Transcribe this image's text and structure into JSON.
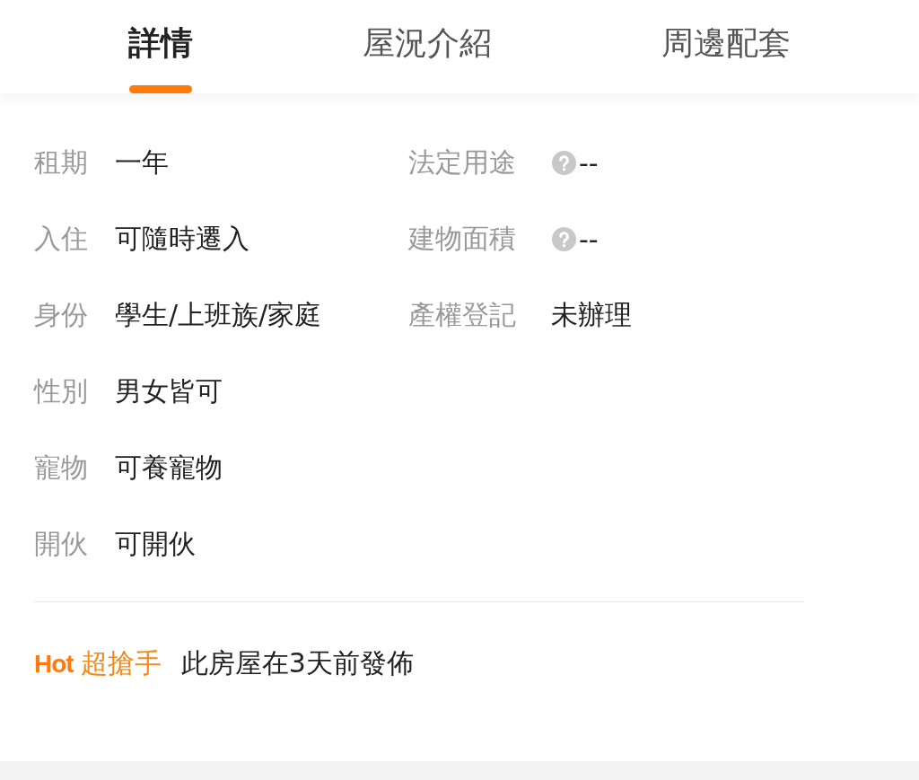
{
  "tabs": [
    {
      "label": "詳情",
      "selected": true
    },
    {
      "label": "屋況介紹",
      "selected": false
    },
    {
      "label": "周邊配套",
      "selected": false
    }
  ],
  "details_left": [
    {
      "label": "租期",
      "value": "一年"
    },
    {
      "label": "入住",
      "value": "可隨時遷入"
    },
    {
      "label": "身份",
      "value": "學生/上班族/家庭"
    },
    {
      "label": "性別",
      "value": "男女皆可"
    },
    {
      "label": "寵物",
      "value": "可養寵物"
    },
    {
      "label": "開伙",
      "value": "可開伙"
    }
  ],
  "details_right": [
    {
      "label": "法定用途",
      "value": "--",
      "kind": "help"
    },
    {
      "label": "建物面積",
      "value": "--",
      "kind": "help"
    },
    {
      "label": "產權登記",
      "value": "未辦理",
      "kind": "text"
    }
  ],
  "notice": {
    "badge": "Hot",
    "tag": "超搶手",
    "text": "此房屋在3天前發佈"
  }
}
